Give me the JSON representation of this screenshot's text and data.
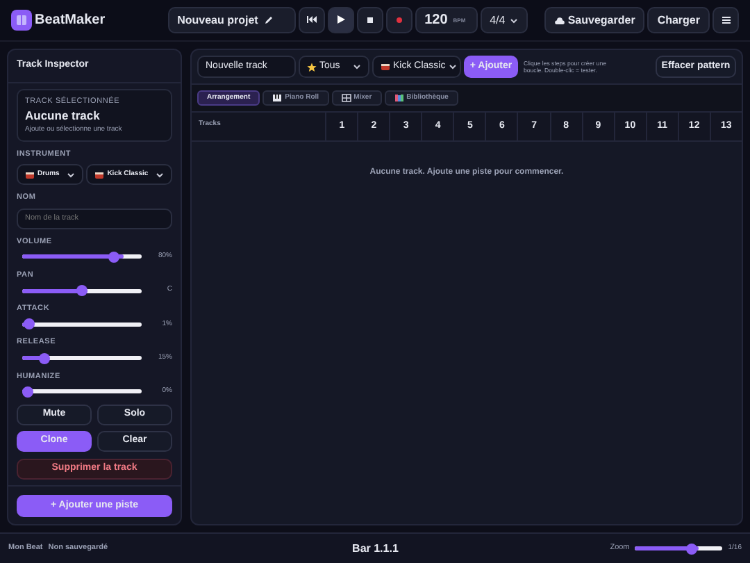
{
  "app": {
    "title": "BeatMaker"
  },
  "toolbar": {
    "project_name": "Nouveau projet",
    "tempo": "120",
    "tempo_unit": "BPM",
    "time_signature": "4/4",
    "save": "Sauvegarder",
    "load": "Charger"
  },
  "inspector": {
    "title": "Track Inspector",
    "selected_label": "TRACK SÉLECTIONNÉE",
    "selected_name": "Aucune track",
    "selected_hint": "Ajoute ou sélectionne une track",
    "instrument_label": "INSTRUMENT",
    "instrument": "Drums",
    "sound": "Kick Classic",
    "name_label": "NOM",
    "name_placeholder": "Nom de la track",
    "sliders": [
      {
        "label": "VOLUME",
        "level": 0.8,
        "reading": "80%"
      },
      {
        "label": "PAN",
        "level": 0.5,
        "reading": "C"
      },
      {
        "label": "ATTACK",
        "level": 0.01,
        "reading": "1%"
      },
      {
        "label": "RELEASE",
        "level": 0.15,
        "reading": "15%"
      },
      {
        "label": "HUMANIZE",
        "level": 0.0,
        "reading": "0%"
      }
    ],
    "buttons": [
      {
        "label": "Mute",
        "selected": false
      },
      {
        "label": "Solo",
        "selected": false
      },
      {
        "label": "Clone",
        "selected": true
      },
      {
        "label": "Clear",
        "selected": false
      }
    ],
    "delete": "Supprimer la track",
    "add": "+ Ajouter une piste"
  },
  "main": {
    "track_name": "Nouvelle track",
    "filter": "Tous",
    "sound": "Kick Classic",
    "add": "+ Ajouter",
    "hint": "Clique les steps pour créer une boucle. Double-clic = tester.",
    "clear": "Effacer pattern",
    "tabs": [
      {
        "label": "Arrangement",
        "selected": true
      },
      {
        "label": "Piano Roll",
        "selected": false
      },
      {
        "label": "Mixer",
        "selected": false
      },
      {
        "label": "Bibliothèque",
        "selected": false
      }
    ],
    "grid": {
      "header": "Tracks",
      "steps": [
        "1",
        "2",
        "3",
        "4",
        "5",
        "6",
        "7",
        "8",
        "9",
        "10",
        "11",
        "12",
        "13"
      ],
      "empty": "Aucune track. Ajoute une piste pour commencer."
    }
  },
  "status_bar": {
    "project": "Mon Beat",
    "save_state": "Non sauvegardé",
    "position": "Bar 1.1.1",
    "zoom_label": "Zoom",
    "zoom": {
      "level": 0.66
    },
    "division": "1/16"
  }
}
